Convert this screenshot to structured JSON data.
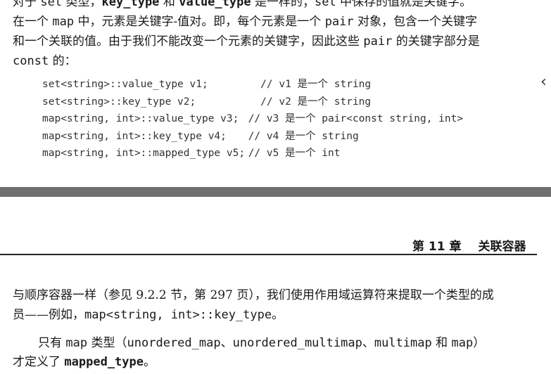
{
  "top_page": {
    "para1_line1": {
      "a": "对于 ",
      "b": "set",
      "c": " 类型，",
      "d": "key_type",
      "e": " 和 ",
      "f": "value_type",
      "g": " 是一样的；",
      "h": "set",
      "i": " 中保存的值就是关键字。"
    },
    "para1_line2": {
      "a": "在一个 ",
      "b": "map",
      "c": " 中，元素是关键字-值对。即，每个元素是一个 ",
      "d": "pair",
      "e": " 对象，包含一个关键字"
    },
    "para1_line3": {
      "a": "和一个关联的值。由于我们不能改变一个元素的关键字，因此这些 ",
      "b": "pair",
      "c": " 的关键字部分是"
    },
    "para1_line4": {
      "a": "const",
      "b": " 的："
    },
    "code": [
      {
        "decl": "set<string>::value_type v1;        ",
        "comment": "// v1 是一个 string"
      },
      {
        "decl": "set<string>::key_type v2;          ",
        "comment": "// v2 是一个 string"
      },
      {
        "decl": "map<string, int>::value_type v3; ",
        "comment": "// v3 是一个 pair<const string, int>"
      },
      {
        "decl": "map<string, int>::key_type v4;   ",
        "comment": "// v4 是一个 string"
      },
      {
        "decl": "map<string, int>::mapped_type v5;",
        "comment": "// v5 是一个 int"
      }
    ]
  },
  "bottom_page": {
    "header": {
      "chapter": "第 11 章",
      "title": "关联容器"
    },
    "para1_line1": "与顺序容器一样（参见 9.2.2 节，第 297 页），我们使用作用域运算符来提取一个类型的成",
    "para1_line2": {
      "a": "员——例如，",
      "b": "map<string, int>::key_type",
      "c": "。"
    },
    "para2_line1": {
      "a": "只有 ",
      "b": "map",
      "c": " 类型（",
      "d": "unordered_map",
      "e": "、",
      "f": "unordered_multimap",
      "g": "、",
      "h": "multimap",
      "i": " 和 ",
      "j": "map",
      "k": "）"
    },
    "para2_line2": {
      "a": "才定义了 ",
      "b": "mapped_type",
      "c": "。"
    }
  },
  "icons": {
    "side_chevron": "chevron-left-icon"
  }
}
